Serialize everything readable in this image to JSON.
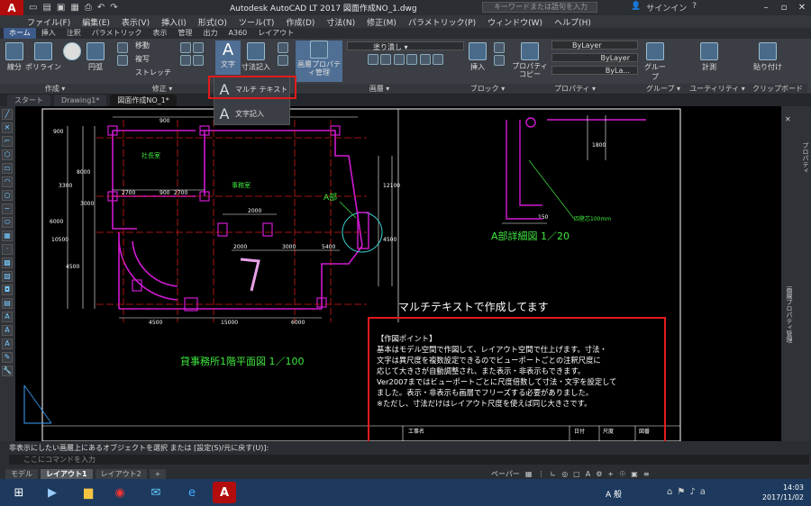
{
  "app": {
    "logo": "A",
    "logo_sub": "LT",
    "title": "Autodesk AutoCAD LT 2017    図面作成NO_1.dwg",
    "search_placeholder": "キーワードまたは語句を入力",
    "signin": "サインイン"
  },
  "menu": [
    "ファイル(F)",
    "編集(E)",
    "表示(V)",
    "挿入(I)",
    "形式(O)",
    "ツール(T)",
    "作成(D)",
    "寸法(N)",
    "修正(M)",
    "パラメトリック(P)",
    "ウィンドウ(W)",
    "ヘルプ(H)"
  ],
  "ribbon_tabs": [
    {
      "label": "ホーム",
      "active": true
    },
    {
      "label": "挿入"
    },
    {
      "label": "注釈"
    },
    {
      "label": "パラメトリック"
    },
    {
      "label": "表示"
    },
    {
      "label": "管理"
    },
    {
      "label": "出力"
    },
    {
      "label": "A360"
    },
    {
      "label": "レイアウト"
    }
  ],
  "ribbon": {
    "draw": {
      "line": "線分",
      "polyline": "ポリライン",
      "circle": "円弧",
      "title": "作成 ▾"
    },
    "modify": {
      "move": "移動",
      "copy": "複写",
      "stretch": "ストレッチ",
      "title": "修正 ▾"
    },
    "annotation": {
      "text": "文字",
      "dimension": "寸法記入"
    },
    "layer": {
      "prop": "画層プロパティ管理",
      "state": "塗り潰し",
      "title": "画層 ▾"
    },
    "block": {
      "insert": "挿入",
      "title": "ブロック ▾"
    },
    "properties": {
      "copy": "プロパティコピー",
      "bylayer1": "ByLayer",
      "bylayer2": "ByLayer",
      "bylayer3": "ByLa...",
      "title": "プロパティ ▾"
    },
    "group": {
      "group": "グループ",
      "title": "グループ ▾"
    },
    "utility": {
      "measure": "計測",
      "title": "ユーティリティ ▾"
    },
    "clipboard": {
      "paste": "貼り付け",
      "title": "クリップボード"
    }
  },
  "dropdown": {
    "mtext": "マルチ テキスト",
    "text": "文字記入"
  },
  "doc_tabs": [
    {
      "label": "スタート"
    },
    {
      "label": "Drawing1*"
    },
    {
      "label": "図面作成NO_1*",
      "active": true
    }
  ],
  "drawing": {
    "room1": "社長室",
    "room2": "事務室",
    "detail_label": "A部",
    "detail_title": "A部詳細図 1／20",
    "plan_title": "貸事務所1階平面図 1／100",
    "heading": "マルチテキストで作成してます",
    "dims": [
      "900",
      "2700",
      "900",
      "2700",
      "4500",
      "15000",
      "6000",
      "4500",
      "15000",
      "6000",
      "2000",
      "2000",
      "3300",
      "12100",
      "4500",
      "3000",
      "8000",
      "10500",
      "150",
      "1800",
      "900",
      "3000",
      "5400",
      "3000"
    ],
    "note_small": "四壁芯100mm",
    "tb1": "工事名",
    "tb2": "日付",
    "tb3": "尺度",
    "tb4": "図番"
  },
  "notes": [
    "【作図ポイント】",
    "基本はモデル空間で作図して、レイアウト空間で仕上げます。寸法・",
    "文字は異尺度を複数設定できるのでビューポートごとの注釈尺度に",
    "応じて大きさが自動調整され、また表示・非表示もできます。",
    "Ver2007まではビューポートごとに尺度倍数して寸法・文字を設定して",
    "ました。表示・非表示も画層でフリーズする必要がありました。",
    "※ただし、寸法だけはレイアウト尺度を使えば同じ大きさです。"
  ],
  "right_panel": {
    "a": "プロパティ",
    "b": "画層プロパティ管理"
  },
  "command": {
    "line1": "非表示にしたい画層上にあるオブジェクトを選択 または [設定(S)/元に戻す(U)]:",
    "placeholder": "ここにコマンドを入力"
  },
  "layout_tabs": [
    {
      "label": "モデル"
    },
    {
      "label": "レイアウト1",
      "active": true
    },
    {
      "label": "レイアウト2"
    },
    {
      "label": "+"
    }
  ],
  "status": {
    "paper": "ペーパー"
  },
  "taskbar": {
    "ime": "A 般",
    "time": "14:03",
    "date": "2017/11/02"
  }
}
